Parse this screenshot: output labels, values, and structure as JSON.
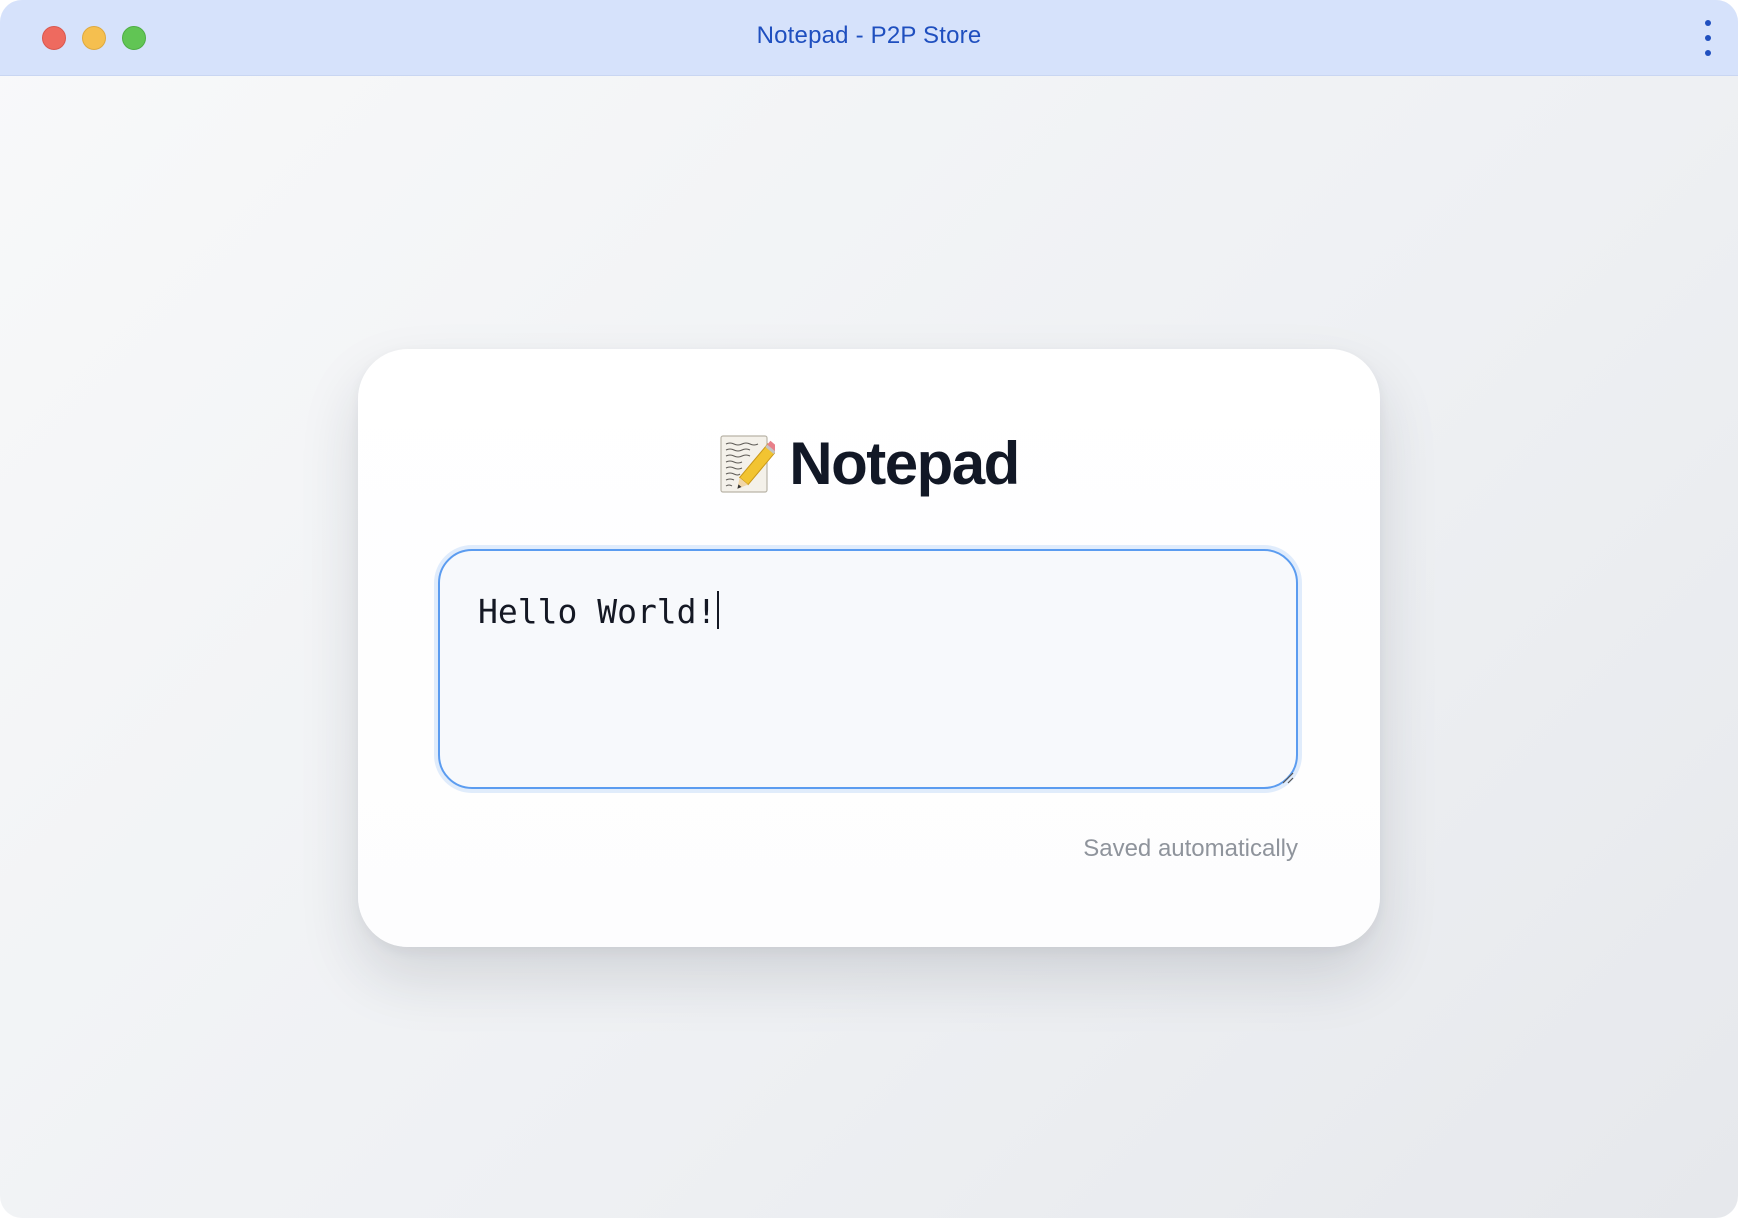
{
  "window": {
    "title": "Notepad - P2P Store",
    "controls": [
      "close",
      "minimize",
      "maximize"
    ],
    "menu_icon": "more-vertical-icon"
  },
  "card": {
    "title_icon": "memo-icon",
    "title": "Notepad",
    "note_text": "Hello World!",
    "status": "Saved automatically"
  },
  "colors": {
    "titlebar_bg": "#d6e2fb",
    "title_color": "#1f4fbf",
    "focus_border": "#5b9cf0",
    "close": "#ee6a5f",
    "minimize": "#f5bf4f",
    "maximize": "#61c554"
  }
}
